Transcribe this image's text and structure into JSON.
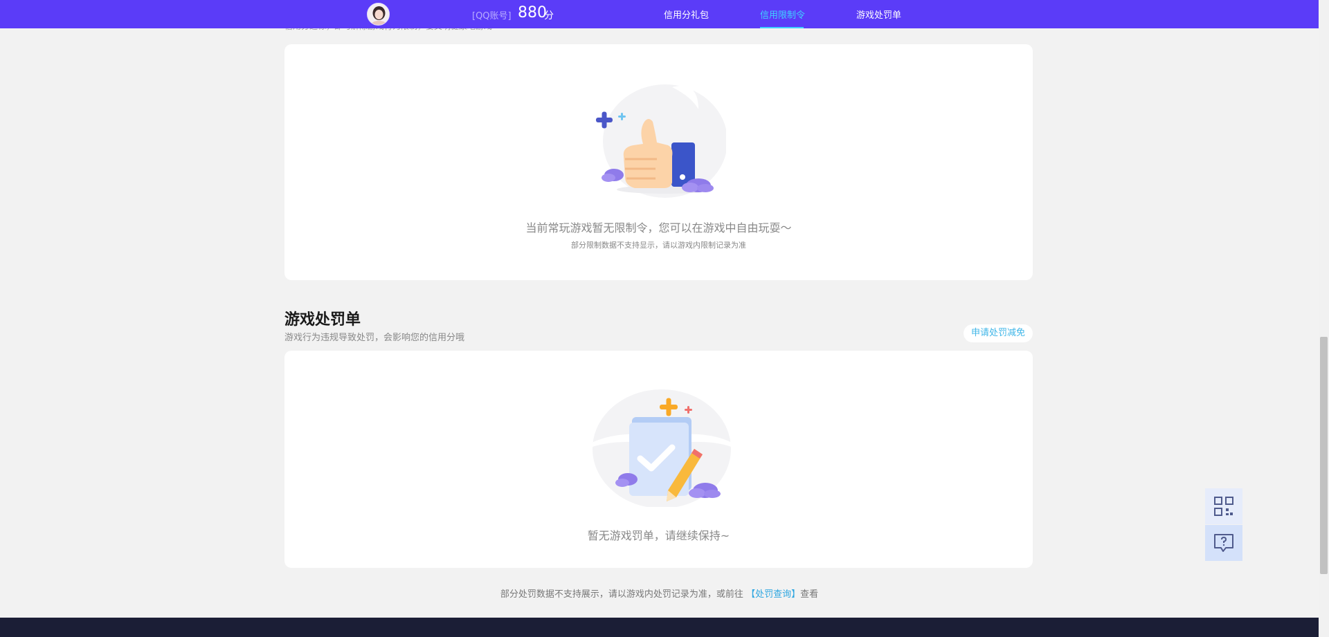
{
  "header": {
    "account_label": "[QQ账号]",
    "score": "880",
    "score_unit": "分",
    "nav": [
      {
        "label": "信用分礼包",
        "active": false
      },
      {
        "label": "信用限制令",
        "active": true
      },
      {
        "label": "游戏处罚单",
        "active": false
      }
    ]
  },
  "restriction": {
    "cut_subtitle": "信用分达标，即可解除游戏行为限制，要文明健康地游戏",
    "empty_main": "当前常玩游戏暂无限制令，您可以在游戏中自由玩耍～",
    "empty_sub": "部分限制数据不支持显示，请以游戏内限制记录为准"
  },
  "penalty": {
    "title": "游戏处罚单",
    "subtitle": "游戏行为违规导致处罚，会影响您的信用分哦",
    "appeal_button": "申请处罚减免",
    "empty_main": "暂无游戏罚单，请继续保持~"
  },
  "footer": {
    "note_prefix": "部分处罚数据不支持展示，请以游戏内处罚记录为准，或前往",
    "note_link": "【处罚查询】",
    "note_suffix": "查看"
  },
  "float_buttons": [
    {
      "icon": "qr-code-icon"
    },
    {
      "icon": "help-chat-icon"
    }
  ],
  "colors": {
    "header_bg": "#5b3cf8",
    "accent": "#3fd2ff",
    "link": "#2ea6e0",
    "footer_bg": "#1b1e36"
  }
}
